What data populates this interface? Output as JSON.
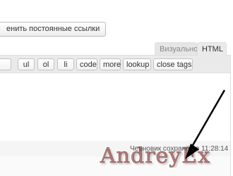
{
  "permalink": {
    "button_label": "енить постоянные ссылки"
  },
  "editor": {
    "tabs": [
      {
        "label": "Визуально",
        "active": false
      },
      {
        "label": "HTML",
        "active": true
      }
    ],
    "quicktags": [
      "ul",
      "ol",
      "li",
      "code",
      "more",
      "lookup",
      "close tags"
    ],
    "status": "Черновик сохранён в 11:28:14"
  },
  "watermark": {
    "text": "AndreyEx"
  },
  "colors": {
    "toolbar_bg": "#eaeaea",
    "watermark": "#8a1a1a",
    "arrow": "#000000"
  }
}
